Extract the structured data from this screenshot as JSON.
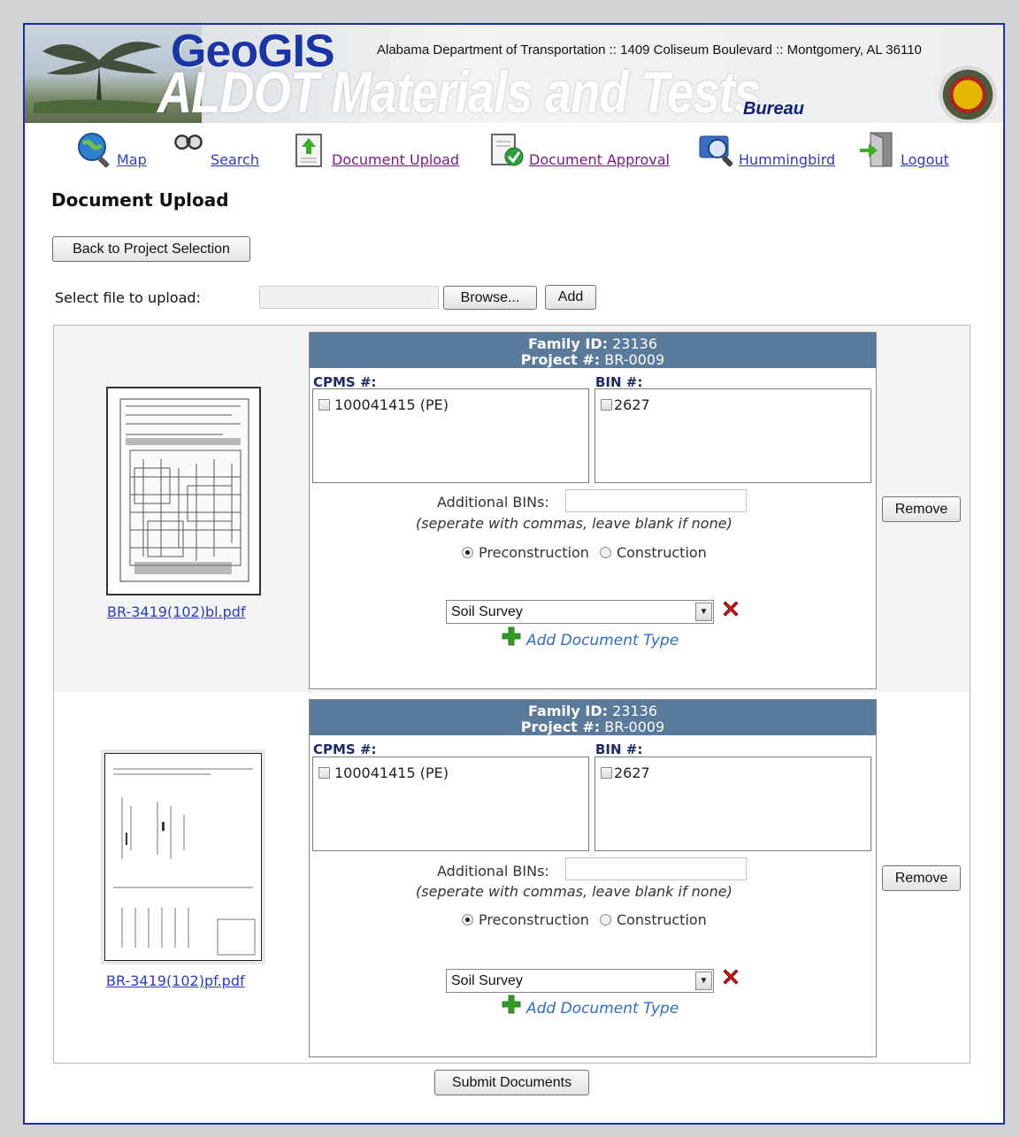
{
  "header": {
    "logo_text": "GeoGIS",
    "address": "Alabama Department of Transportation :: 1409 Coliseum Boulevard :: Montgomery, AL 36110",
    "title": "ALDOT Materials and Tests",
    "subtitle": "Bureau"
  },
  "nav": {
    "items": [
      {
        "label": "Map",
        "icon": "globe-magnifier-icon"
      },
      {
        "label": "Search",
        "icon": "binoculars-icon"
      },
      {
        "label": "Document Upload",
        "icon": "document-upload-icon"
      },
      {
        "label": "Document Approval",
        "icon": "document-approval-icon"
      },
      {
        "label": "Hummingbird",
        "icon": "hummingbird-search-icon"
      },
      {
        "label": "Logout",
        "icon": "logout-door-icon"
      }
    ]
  },
  "page": {
    "title": "Document Upload",
    "back_button": "Back to Project Selection",
    "select_file_label": "Select file to upload:",
    "browse_button": "Browse...",
    "add_button": "Add",
    "submit_button": "Submit Documents"
  },
  "documents": [
    {
      "file_name": "BR-3419(102)bl.pdf",
      "family_id_label": "Family ID:",
      "family_id": "23136",
      "project_label": "Project #:",
      "project": "BR-0009",
      "cpms_label": "CPMS #:",
      "cpms_item": "100041415 (PE)",
      "bin_label": "BIN #:",
      "bin_item": "2627",
      "additional_bins_label": "Additional BINs:",
      "additional_bins_value": "",
      "hint": "(seperate with commas, leave blank if none)",
      "phase_options": [
        "Preconstruction",
        "Construction"
      ],
      "phase_selected": "Preconstruction",
      "doc_type": "Soil Survey",
      "add_doc_type": "Add Document Type",
      "remove_button": "Remove"
    },
    {
      "file_name": "BR-3419(102)pf.pdf",
      "family_id_label": "Family ID:",
      "family_id": "23136",
      "project_label": "Project #:",
      "project": "BR-0009",
      "cpms_label": "CPMS #:",
      "cpms_item": "100041415 (PE)",
      "bin_label": "BIN #:",
      "bin_item": "2627",
      "additional_bins_label": "Additional BINs:",
      "additional_bins_value": "",
      "hint": "(seperate with commas, leave blank if none)",
      "phase_options": [
        "Preconstruction",
        "Construction"
      ],
      "phase_selected": "Preconstruction",
      "doc_type": "Soil Survey",
      "add_doc_type": "Add Document Type",
      "remove_button": "Remove"
    }
  ],
  "colors": {
    "frame_border": "#1a2fa0",
    "panel_header": "#5a7a9c",
    "link": "#2b3cc5",
    "visited_link": "#7a1a8a",
    "add_type_link": "#2b6ec7",
    "delete_red": "#cc1111",
    "add_green": "#2e9e1e"
  }
}
